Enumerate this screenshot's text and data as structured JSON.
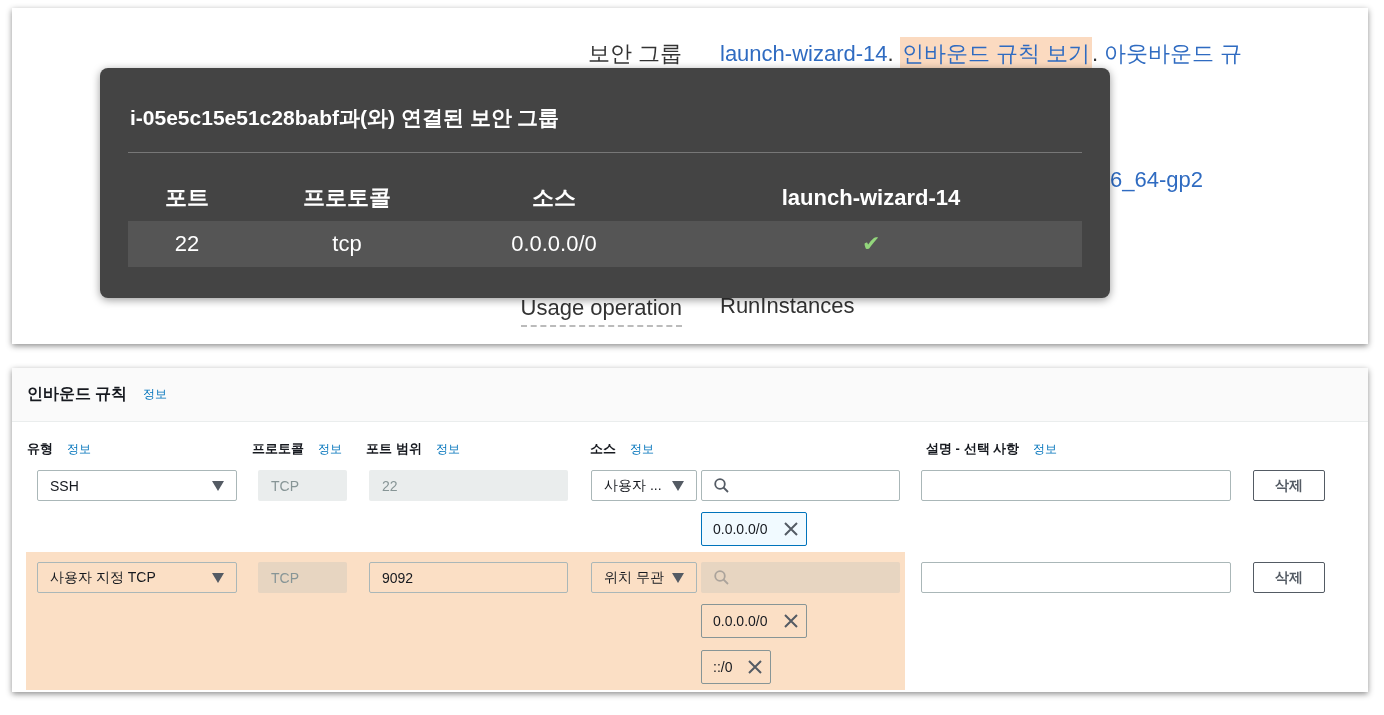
{
  "details": {
    "rows": [
      {
        "label": "보안 그룹",
        "label_underlined": false,
        "parts": [
          {
            "text": "launch-wizard-14",
            "kind": "link",
            "highlighted": false
          },
          {
            "text": ".",
            "kind": "plain",
            "highlighted": false
          },
          {
            "text": "인바운드 규칙 보기",
            "kind": "link",
            "highlighted": true
          },
          {
            "text": ".",
            "kind": "plain",
            "highlighted": false
          },
          {
            "text": "아웃바운드 규",
            "kind": "link",
            "highlighted": false
          }
        ]
      },
      {
        "parts": [
          {
            "text": "6_64-gp2",
            "kind": "link",
            "highlighted": false
          }
        ]
      },
      {
        "label": "Usage operation",
        "label_underlined": true,
        "parts": [
          {
            "text": "RunInstances",
            "kind": "plain",
            "highlighted": false
          }
        ]
      }
    ]
  },
  "popover": {
    "title": "i-05e5c15e51c28babf과(와) 연결된 보안 그룹",
    "columns": [
      "포트",
      "프로토콜",
      "소스",
      "launch-wizard-14"
    ],
    "rows": [
      [
        "22",
        "tcp",
        "0.0.0.0/0",
        "✔"
      ]
    ]
  },
  "inbound": {
    "title": "인바운드 규칙",
    "info": "정보",
    "columns": [
      {
        "label": "유형",
        "info": "정보"
      },
      {
        "label": "프로토콜",
        "info": "정보"
      },
      {
        "label": "포트 범위",
        "info": "정보"
      },
      {
        "label": "소스",
        "info": "정보"
      },
      {
        "label": "설명 - 선택 사항",
        "info": "정보"
      }
    ],
    "rules": [
      {
        "highlighted": false,
        "type": "SSH",
        "protocol": "TCP",
        "port": "22",
        "port_disabled": true,
        "source": "사용자 ...",
        "search_disabled": false,
        "sources": [
          {
            "text": "0.0.0.0/0",
            "active": true
          }
        ],
        "delete": "삭제"
      },
      {
        "highlighted": true,
        "type": "사용자 지정 TCP",
        "protocol": "TCP",
        "port": "9092",
        "port_disabled": false,
        "source": "위치 무관",
        "search_disabled": true,
        "sources": [
          {
            "text": "0.0.0.0/0",
            "active": false
          },
          {
            "text": "::/0",
            "active": false
          }
        ],
        "delete": "삭제"
      }
    ]
  }
}
